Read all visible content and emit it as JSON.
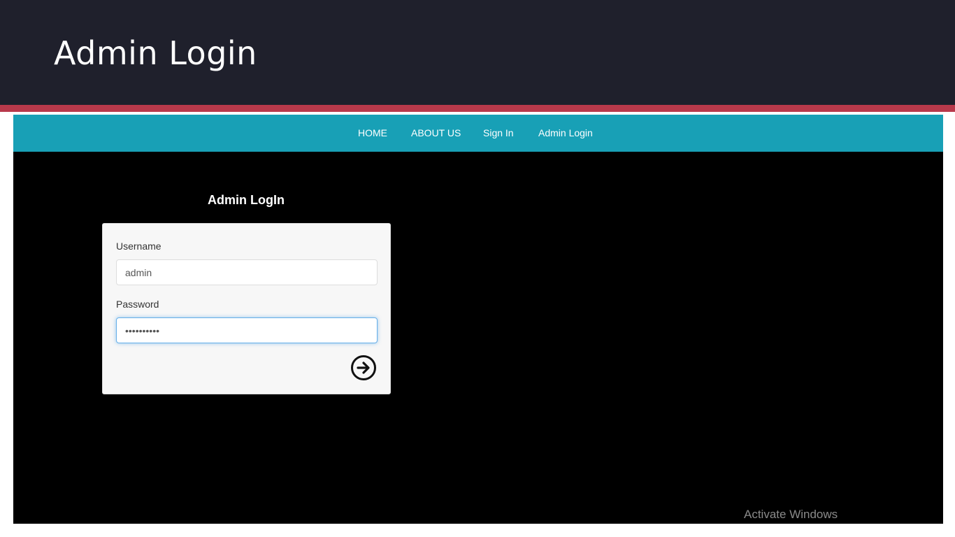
{
  "slide": {
    "title": "Admin Login",
    "colors": {
      "header_bg": "#1f202c",
      "accent": "#b8394b"
    }
  },
  "navbar": {
    "bg_color": "#18a0b6",
    "items": [
      {
        "label": "HOME"
      },
      {
        "label": "ABOUT US"
      },
      {
        "label": "Sign In"
      },
      {
        "label": "Admin Login"
      }
    ]
  },
  "login": {
    "heading": "Admin LogIn",
    "username_label": "Username",
    "username_value": "admin",
    "password_label": "Password",
    "password_value": "••••••••••",
    "submit_icon": "arrow-right-circle-icon"
  },
  "watermark": "Activate Windows"
}
